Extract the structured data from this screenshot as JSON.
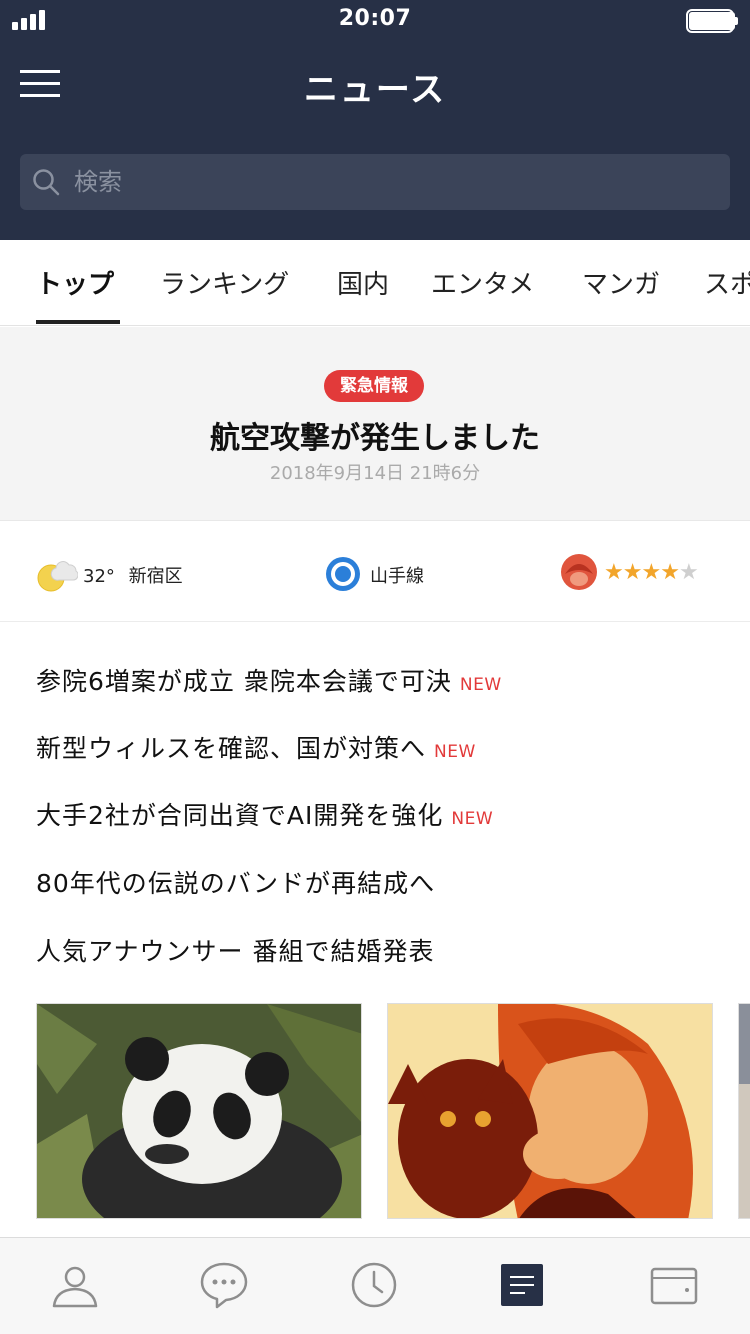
{
  "status": {
    "time": "20:07"
  },
  "header": {
    "title": "ニュース"
  },
  "search": {
    "placeholder": "検索"
  },
  "tabs": [
    {
      "label": "トップ",
      "active": true
    },
    {
      "label": "ランキング"
    },
    {
      "label": "国内"
    },
    {
      "label": "エンタメ"
    },
    {
      "label": "マンガ"
    },
    {
      "label": "スポ"
    }
  ],
  "alert": {
    "badge": "緊急情報",
    "title": "航空攻撃が発生しました",
    "date": "2018年9月14日 21時6分",
    "badge_color": "#e23a3a"
  },
  "widgets": {
    "weather": {
      "temp": "32°",
      "location": "新宿区",
      "icon": "sun-cloud-icon"
    },
    "train": {
      "line": "山手線",
      "icon": "train-line-icon"
    },
    "fortune": {
      "rating": 4,
      "max": 5,
      "icon": "fortune-avatar-icon"
    }
  },
  "headlines": [
    {
      "text": "参院6増案が成立 衆院本会議で可決",
      "new": "NEW"
    },
    {
      "text": "新型ウィルスを確認、国が対策へ",
      "new": "NEW"
    },
    {
      "text": "大手2社が合同出資でAI開発を強化",
      "new": "NEW"
    },
    {
      "text": "80年代の伝説のバンドが再結成へ",
      "new": ""
    },
    {
      "text": "人気アナウンサー 番組で結婚発表",
      "new": ""
    }
  ],
  "bottom_nav": [
    {
      "name": "friends",
      "icon": "person-icon"
    },
    {
      "name": "chats",
      "icon": "chat-bubble-icon"
    },
    {
      "name": "timeline",
      "icon": "clock-icon"
    },
    {
      "name": "news",
      "icon": "news-icon",
      "active": true
    },
    {
      "name": "wallet",
      "icon": "wallet-icon"
    }
  ],
  "colors": {
    "header_bg": "#273046",
    "accent_red": "#e23a3a",
    "star_on": "#f2a52b",
    "active_nav": "#273046"
  }
}
